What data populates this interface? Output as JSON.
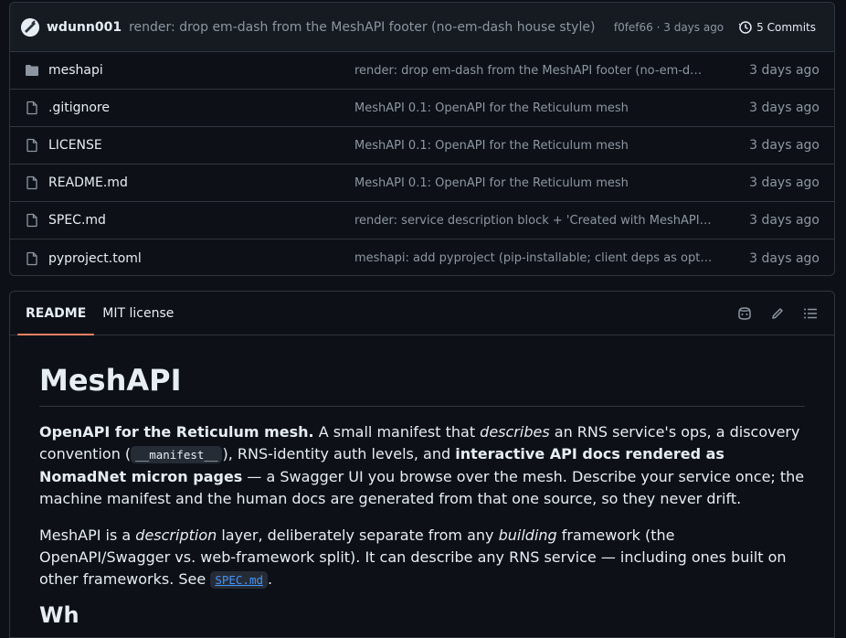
{
  "commit_bar": {
    "author": "wdunn001",
    "message": "render: drop em-dash from the MeshAPI footer (no-em-dash house style)",
    "meta": "f0fef66 · 3 days ago",
    "commits_label": "5 Commits"
  },
  "files": [
    {
      "name": "meshapi",
      "type": "folder",
      "commit": "render: drop em-dash from the MeshAPI footer (no-em-d…",
      "age": "3 days ago"
    },
    {
      "name": ".gitignore",
      "type": "file",
      "commit": "MeshAPI 0.1: OpenAPI for the Reticulum mesh",
      "age": "3 days ago"
    },
    {
      "name": "LICENSE",
      "type": "file",
      "commit": "MeshAPI 0.1: OpenAPI for the Reticulum mesh",
      "age": "3 days ago"
    },
    {
      "name": "README.md",
      "type": "file",
      "commit": "MeshAPI 0.1: OpenAPI for the Reticulum mesh",
      "age": "3 days ago"
    },
    {
      "name": "SPEC.md",
      "type": "file",
      "commit": "render: service description block + 'Created with MeshAPI…",
      "age": "3 days ago"
    },
    {
      "name": "pyproject.toml",
      "type": "file",
      "commit": "meshapi: add pyproject (pip-installable; client deps as opt…",
      "age": "3 days ago"
    }
  ],
  "readme": {
    "tabs": [
      "README",
      "MIT license"
    ],
    "title": "MeshAPI",
    "p1": {
      "s1": "OpenAPI for the Reticulum mesh.",
      "s2": " A small manifest that ",
      "s3": "describes",
      "s4": " an RNS service's ops, a discovery convention (",
      "code": "__manifest__",
      "s5": "), RNS-identity auth levels, and ",
      "s6": "interactive API docs rendered as NomadNet micron pages",
      "s7": " — a Swagger UI you browse over the mesh. Describe your service once; the machine manifest and the human docs are generated from that one source, so they never drift."
    },
    "p2": {
      "s1": "MeshAPI is a ",
      "s2": "description",
      "s3": " layer, deliberately separate from any ",
      "s4": "building",
      "s5": " framework (the OpenAPI/Swagger vs. web-framework split). It can describe any RNS service — including ones built on other frameworks. See ",
      "link": "SPEC.md",
      "s6": "."
    },
    "next_heading": "Wh"
  },
  "colors": {
    "background": "#0d1117",
    "border": "#30363d",
    "muted": "#8d96a0",
    "accent_tab": "#f78166",
    "link": "#4493f8"
  }
}
